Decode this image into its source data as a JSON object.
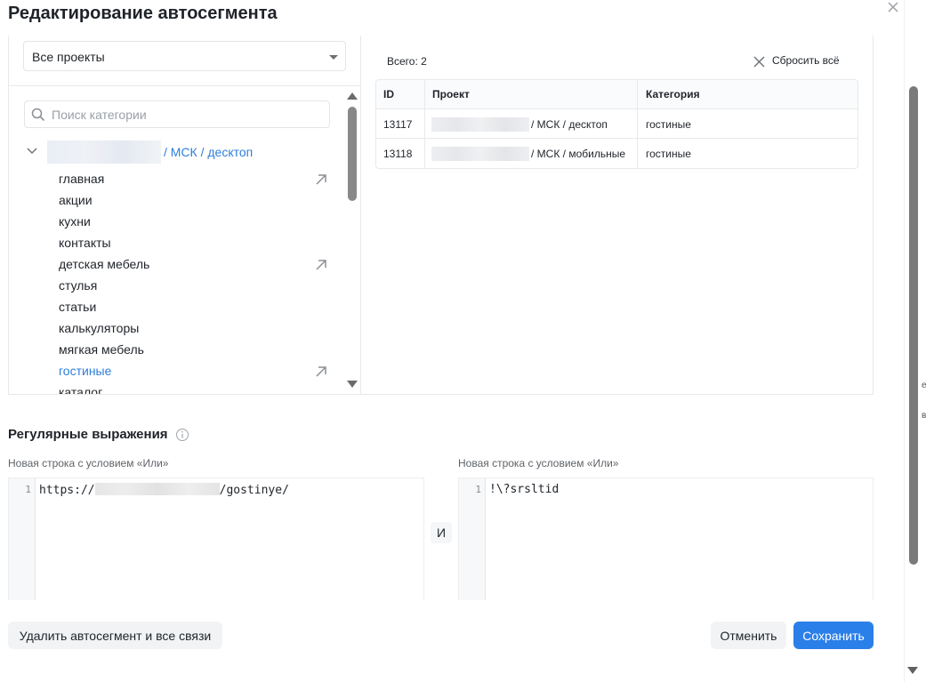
{
  "modal": {
    "title": "Редактирование автосегмента"
  },
  "project_filter": {
    "selected": "Все проекты"
  },
  "search": {
    "placeholder": "Поиск категории"
  },
  "tree": {
    "root_path": "/ МСК / десктоп",
    "categories": [
      {
        "label": "главная",
        "linked": true
      },
      {
        "label": "акции",
        "linked": false
      },
      {
        "label": "кухни",
        "linked": false
      },
      {
        "label": "контакты",
        "linked": false
      },
      {
        "label": "детская мебель",
        "linked": true
      },
      {
        "label": "стулья",
        "linked": false
      },
      {
        "label": "статьи",
        "linked": false
      },
      {
        "label": "калькуляторы",
        "linked": false
      },
      {
        "label": "мягкая мебель",
        "linked": false
      },
      {
        "label": "гостиные",
        "linked": true,
        "active": true
      },
      {
        "label": "каталог",
        "linked": false
      }
    ]
  },
  "selection": {
    "total_label": "Всего: 2",
    "reset_label": "Сбросить всё",
    "columns": [
      "ID",
      "Проект",
      "Категория"
    ],
    "rows": [
      {
        "id": "13117",
        "project": "/ МСК / десктоп",
        "category": "гостиные"
      },
      {
        "id": "13118",
        "project": "/ МСК / мобильные",
        "category": "гостиные"
      }
    ]
  },
  "regex": {
    "title": "Регулярные выражения",
    "left_hint": "Новая строка с условием «Или»",
    "right_hint": "Новая строка с условием «Или»",
    "and_label": "И",
    "left_editor": {
      "line": "1",
      "prefix": "https://",
      "suffix": "/gostinye/"
    },
    "right_editor": {
      "line": "1",
      "code": "!\\?srsltid"
    }
  },
  "footer": {
    "delete_label": "Удалить автосегмент и все связи",
    "cancel_label": "Отменить",
    "save_label": "Сохранить"
  },
  "edge_letters": [
    "е",
    "в"
  ],
  "colors": {
    "accent": "#2b7fe8",
    "link": "#2d7fd8"
  }
}
